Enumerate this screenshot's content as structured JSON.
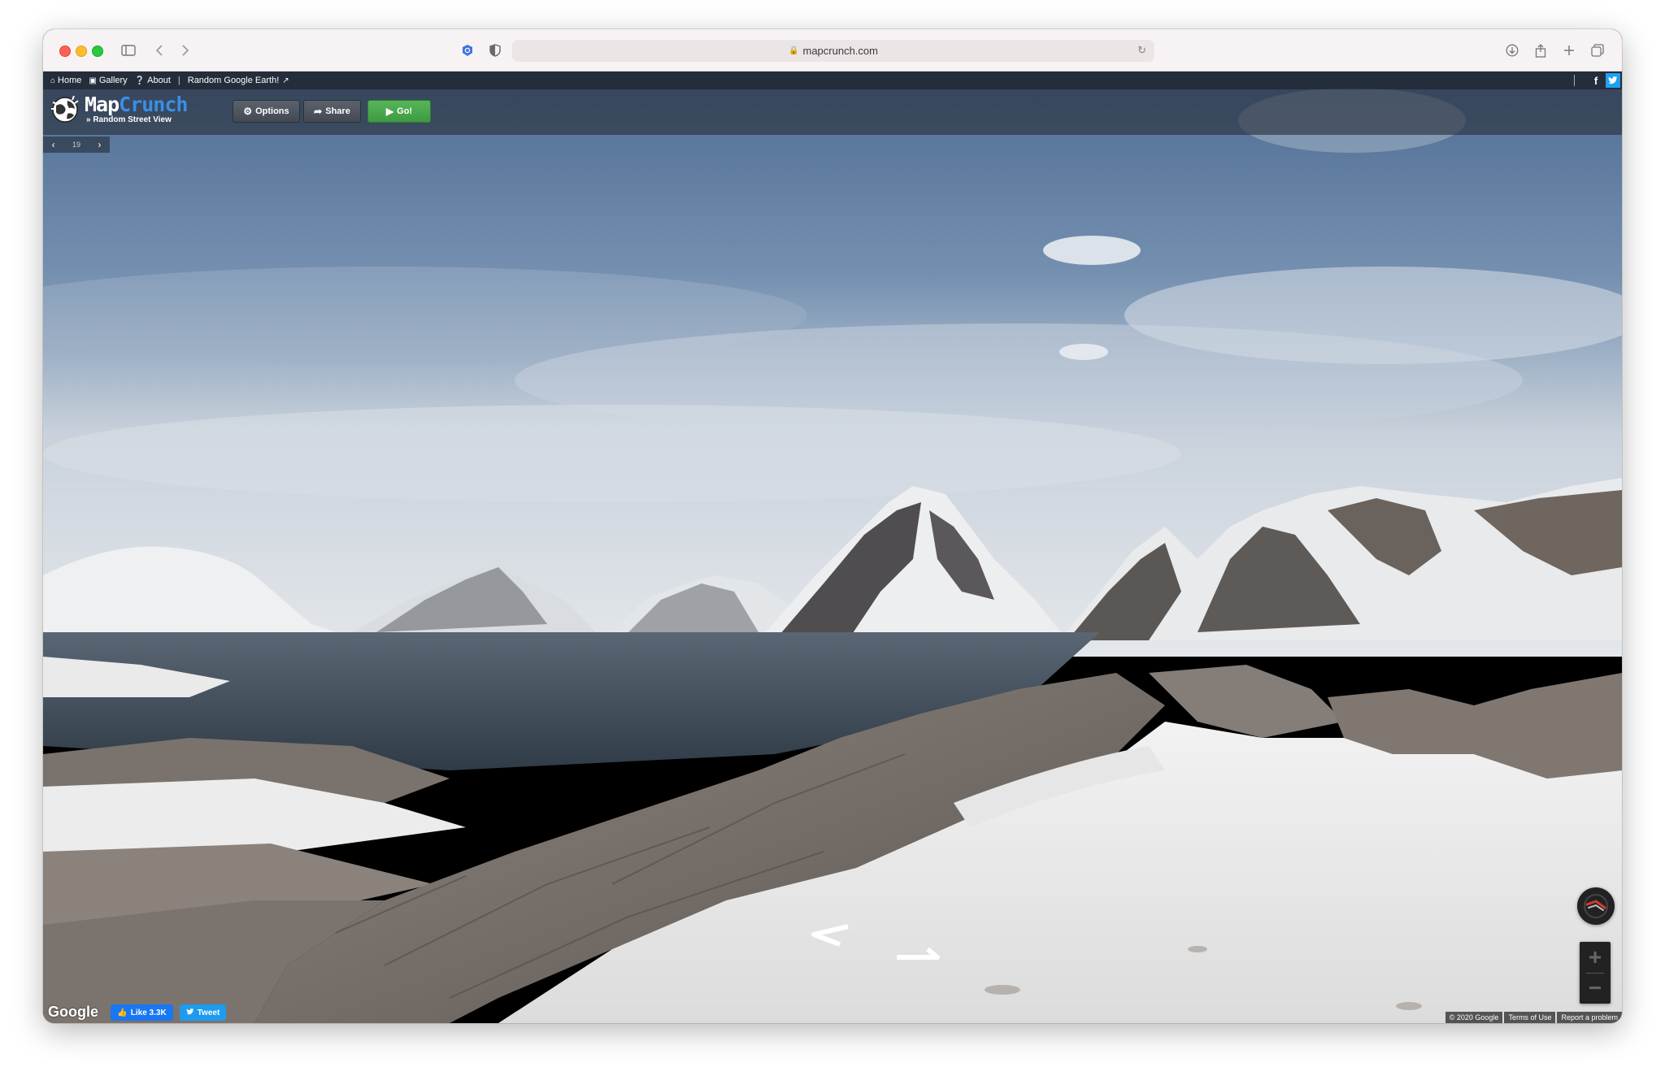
{
  "browser": {
    "url": "mapcrunch.com"
  },
  "nav": {
    "home": "Home",
    "gallery": "Gallery",
    "about": "About",
    "earth": "Random Google Earth!"
  },
  "header": {
    "brand_map": "Map",
    "brand_crunch": "Crunch",
    "tagline": "» Random Street View",
    "options": "Options",
    "share": "Share",
    "go": "Go!"
  },
  "history": {
    "count": "19"
  },
  "social": {
    "facebook": "f",
    "twitter": "t"
  },
  "footer": {
    "google": "Google",
    "like": "Like 3.3K",
    "tweet": "Tweet",
    "copyright": "© 2020 Google",
    "terms": "Terms of Use",
    "report": "Report a problem"
  },
  "colors": {
    "go_button": "#4caf50",
    "brand_crunch": "#3a8ee6",
    "facebook": "#1877f2",
    "twitter": "#1da1f2"
  }
}
